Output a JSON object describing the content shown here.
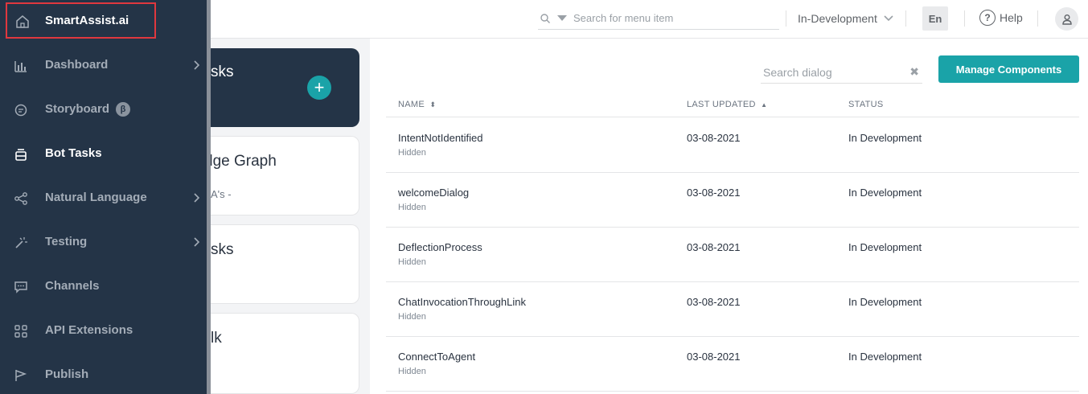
{
  "topbar": {
    "search_placeholder": "Search for menu item",
    "environment": "In-Development",
    "language": "En",
    "help_label": "Help"
  },
  "sidebar": {
    "brand": "SmartAssist.ai",
    "items": [
      {
        "label": "Dashboard",
        "icon": "bar-chart-icon",
        "has_submenu": true,
        "active": false
      },
      {
        "label": "Storyboard",
        "icon": "storyboard-icon",
        "has_submenu": false,
        "active": false,
        "badge": "β"
      },
      {
        "label": "Bot Tasks",
        "icon": "bot-tasks-icon",
        "has_submenu": false,
        "active": true
      },
      {
        "label": "Natural Language",
        "icon": "share-nodes-icon",
        "has_submenu": true,
        "active": false
      },
      {
        "label": "Testing",
        "icon": "magic-wand-icon",
        "has_submenu": true,
        "active": false
      },
      {
        "label": "Channels",
        "icon": "chat-icon",
        "has_submenu": false,
        "active": false
      },
      {
        "label": "API Extensions",
        "icon": "grid-icon",
        "has_submenu": false,
        "active": false
      },
      {
        "label": "Publish",
        "icon": "flag-icon",
        "has_submenu": false,
        "active": false
      }
    ]
  },
  "cards": [
    {
      "title": "sks",
      "subtitle": ""
    },
    {
      "title": "dge Graph",
      "subtitle": "A's -"
    },
    {
      "title": "sks",
      "subtitle": ""
    },
    {
      "title": "lk",
      "subtitle": ""
    }
  ],
  "main": {
    "search_placeholder": "Search dialog",
    "manage_button": "Manage Components",
    "columns": [
      "NAME",
      "LAST UPDATED",
      "STATUS"
    ],
    "rows": [
      {
        "name": "IntentNotIdentified",
        "visibility": "Hidden",
        "updated": "03-08-2021",
        "status": "In Development"
      },
      {
        "name": "welcomeDialog",
        "visibility": "Hidden",
        "updated": "03-08-2021",
        "status": "In Development"
      },
      {
        "name": "DeflectionProcess",
        "visibility": "Hidden",
        "updated": "03-08-2021",
        "status": "In Development"
      },
      {
        "name": "ChatInvocationThroughLink",
        "visibility": "Hidden",
        "updated": "03-08-2021",
        "status": "In Development"
      },
      {
        "name": "ConnectToAgent",
        "visibility": "Hidden",
        "updated": "03-08-2021",
        "status": "In Development"
      }
    ]
  },
  "colors": {
    "sidebar_bg": "#243447",
    "accent": "#1aa3a8",
    "brand_highlight_border": "#e0383e"
  }
}
